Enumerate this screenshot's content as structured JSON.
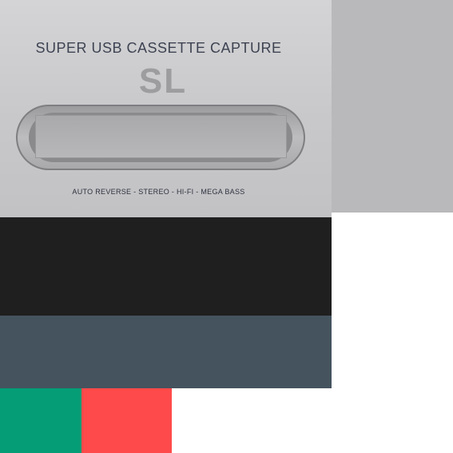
{
  "photo": {
    "brand_title": "SUPER USB CASSETTE CAPTURE",
    "logo_text": "SL",
    "features": "AUTO REVERSE - STEREO - HI-FI - MEGA BASS",
    "colors": {
      "faceplate": "#c9c9cb",
      "text": "#3e4352",
      "logo": "#9d9d9f"
    }
  },
  "palette": {
    "band_dark": "#1f1f1f",
    "band_slate": "#45535e",
    "swatch_green": "#049d76",
    "swatch_red": "#fe4a4a",
    "side_gray": "#b9b9bb"
  }
}
